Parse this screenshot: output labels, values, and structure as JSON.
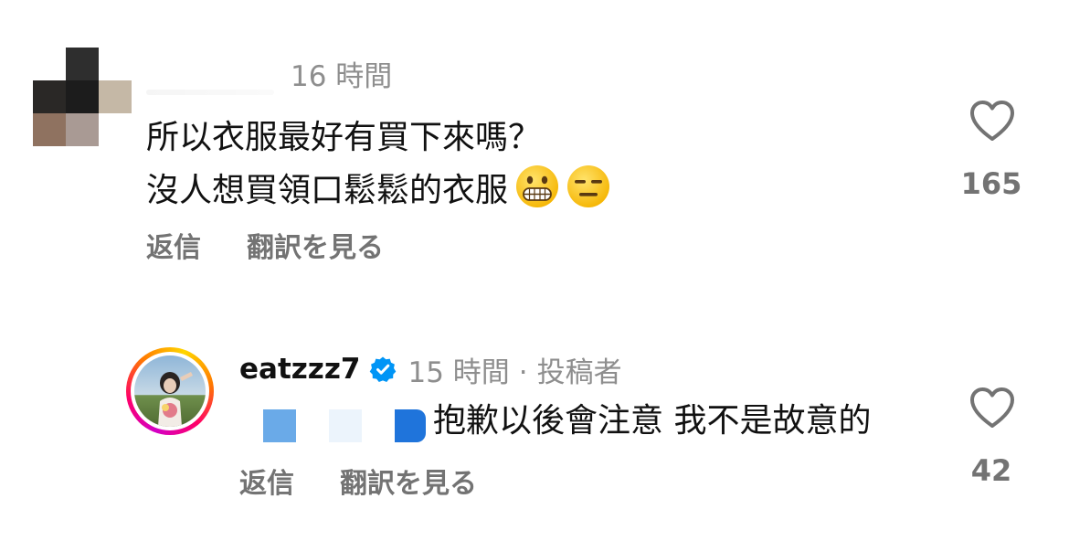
{
  "comments": [
    {
      "time": "16 時間",
      "text_lines": [
        "所以衣服最好有買下來嗎？",
        "沒人想買領口鬆鬆的衣服"
      ],
      "emojis": [
        "grimacing-face",
        "expressionless-face"
      ],
      "actions": {
        "reply": "返信",
        "translate": "翻訳を見る"
      },
      "likes": "165"
    },
    {
      "username": "eatzzz7",
      "verified": true,
      "time": "15 時間",
      "separator": "·",
      "role": "投稿者",
      "text": "抱歉以後會注意 我不是故意的",
      "actions": {
        "reply": "返信",
        "translate": "翻訳を見る"
      },
      "likes": "42"
    }
  ],
  "colors": {
    "text": "#111111",
    "muted": "#737373",
    "timestamp": "#8e8e8e",
    "verified_badge": "#0095f6",
    "story_ring": [
      "#d300c5",
      "#ff0069",
      "#ff7a00",
      "#ffd600"
    ]
  }
}
